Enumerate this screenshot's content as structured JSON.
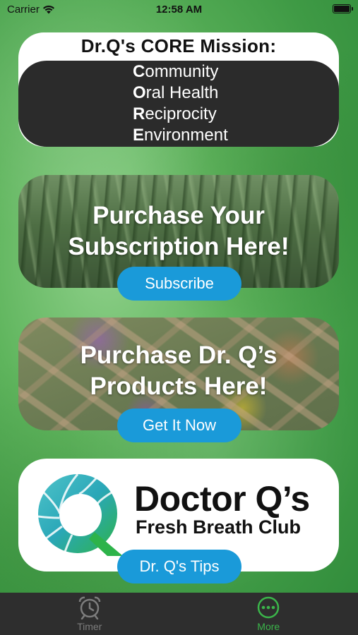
{
  "status_bar": {
    "carrier": "Carrier",
    "time": "12:58 AM"
  },
  "mission": {
    "title": "Dr.Q's CORE Mission:",
    "items": [
      {
        "initial": "C",
        "rest": "ommunity"
      },
      {
        "initial": "O",
        "rest": "ral Health"
      },
      {
        "initial": "R",
        "rest": "eciprocity"
      },
      {
        "initial": "E",
        "rest": "nvironment"
      }
    ]
  },
  "subscription_banner": {
    "line1": "Purchase Your",
    "line2": "Subscription Here!",
    "button_label": "Subscribe"
  },
  "products_banner": {
    "line1": "Purchase Dr. Q’s",
    "line2": "Products Here!",
    "button_label": "Get It Now"
  },
  "logo_card": {
    "title": "Doctor Q’s",
    "subtitle": "Fresh Breath Club",
    "button_label": "Dr. Q's Tips"
  },
  "tab_bar": {
    "tabs": [
      {
        "label": "Timer",
        "icon": "alarm-clock-icon",
        "selected": false
      },
      {
        "label": "More",
        "icon": "more-circle-icon",
        "selected": true
      }
    ]
  },
  "colors": {
    "button_blue": "#1a9ad9",
    "active_tab_green": "#3bb54a",
    "tab_bar_bg": "#2e2e2e",
    "mission_dark": "#2b2b2b"
  }
}
